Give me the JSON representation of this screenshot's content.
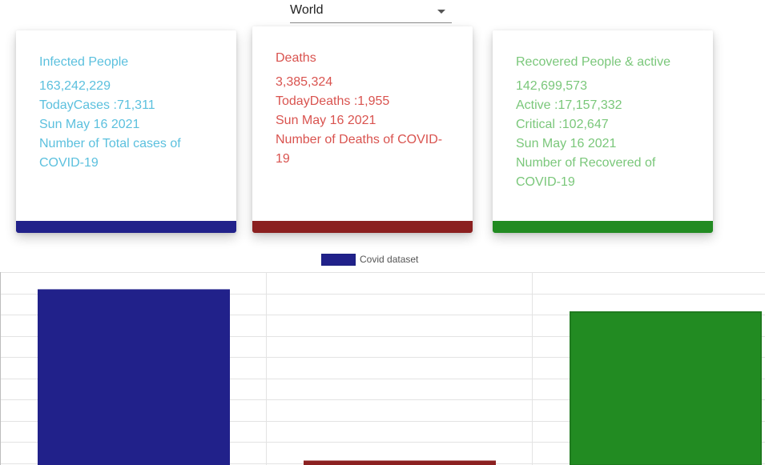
{
  "selector": {
    "value": "World"
  },
  "cards": {
    "infected": {
      "title": "Infected People",
      "total": "163,242,229",
      "today": "TodayCases :71,311",
      "date": "Sun May 16 2021",
      "desc_line1": "Number of Total cases of",
      "desc_line2": "COVID-19",
      "color": "#5bc0de",
      "bar_color": "#21218a"
    },
    "deaths": {
      "title": "Deaths",
      "total": "3,385,324",
      "today": "TodayDeaths :1,955",
      "date": "Sun May 16 2021",
      "desc_line1": "Number of Deaths of COVID-",
      "desc_line2": "19",
      "color": "#d9534f",
      "bar_color": "#8b2020"
    },
    "recovered": {
      "title": "Recovered People & active",
      "total": "142,699,573",
      "active": "Active :17,157,332",
      "critical": "Critical :102,647",
      "date": "Sun May 16 2021",
      "desc_line1": "Number of Recovered of",
      "desc_line2": "COVID-19",
      "color": "#7ac77a",
      "bar_color": "#228b22"
    }
  },
  "chart_data": {
    "type": "bar",
    "categories": [
      "Infected People",
      "Deaths",
      "Recovered People & active"
    ],
    "series": [
      {
        "name": "Covid dataset",
        "values": [
          163242229,
          3385324,
          142699573
        ]
      }
    ],
    "colors": [
      "#21218a",
      "#8b2020",
      "#228b22"
    ],
    "legend": "top-center",
    "grid": true
  }
}
